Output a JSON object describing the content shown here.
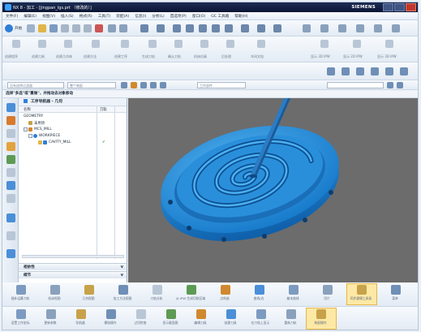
{
  "window": {
    "title": "NX 8 - 加工 - [jingpan_lgs.prt （修改的）]",
    "brand": "SIEMENS",
    "colors": {
      "title_bg": "#102046",
      "accent": "#2f7fd8",
      "part_blue": "#2b98e4",
      "viewport_bg": "#6c6c6c"
    }
  },
  "menu": [
    "文件(F)",
    "编辑(E)",
    "视图(V)",
    "插入(S)",
    "格式(R)",
    "工具(T)",
    "装配(A)",
    "信息(I)",
    "分析(L)",
    "首选项(P)",
    "窗口(O)",
    "GC 工具箱",
    "帮助(H)"
  ],
  "toolbar1": {
    "start_label": "开始"
  },
  "toolbar2": {
    "items": [
      "创建程序",
      "创建刀具",
      "创建几何体",
      "创建方法",
      "创建工序",
      "生成刀轨",
      "确认刀轨",
      "机床仿真",
      "后处理",
      "车间文档",
      "显示 3D IPW",
      "显示 2D IPW",
      "显示 3D IPW"
    ]
  },
  "select_bar": {
    "filter": "没有选择过滤器",
    "assembly": "整个装配",
    "part_nav": "工作部件"
  },
  "hint": "选择\"多选\"或\"重做\"，并拖动去对象移动",
  "navigator": {
    "title": "工序导航器 - 几何",
    "col_name": "名称",
    "col_tool": "刀轨",
    "rows": [
      {
        "name": "GEOMETRY",
        "status": ""
      },
      {
        "name": "未用项",
        "status": ""
      },
      {
        "name": "MCS_MILL",
        "status": ""
      },
      {
        "name": "WORKPIECE",
        "status": ""
      },
      {
        "name": "CAVITY_MILL",
        "status": "✔"
      }
    ],
    "sections": [
      "相依性",
      "细节"
    ]
  },
  "bottom_toolbar1": [
    "插补运算刀轨",
    "机床视图",
    "几何视图",
    "加工方法视图",
    "刀轨分析",
    "从 IPW 生成切削区域",
    "点构造",
    "曲线/边",
    "基本曲线",
    "切片",
    "同步建模工具条",
    "菜单"
  ],
  "bottom_toolbar2": [
    "设置工作坐标",
    "更新参数",
    "导航器",
    "模拟操作",
    "过切检查",
    "显示截面图",
    "编辑刀具",
    "创建刀具",
    "在刀轨上显示",
    "重新刀轨",
    "装配操作"
  ]
}
